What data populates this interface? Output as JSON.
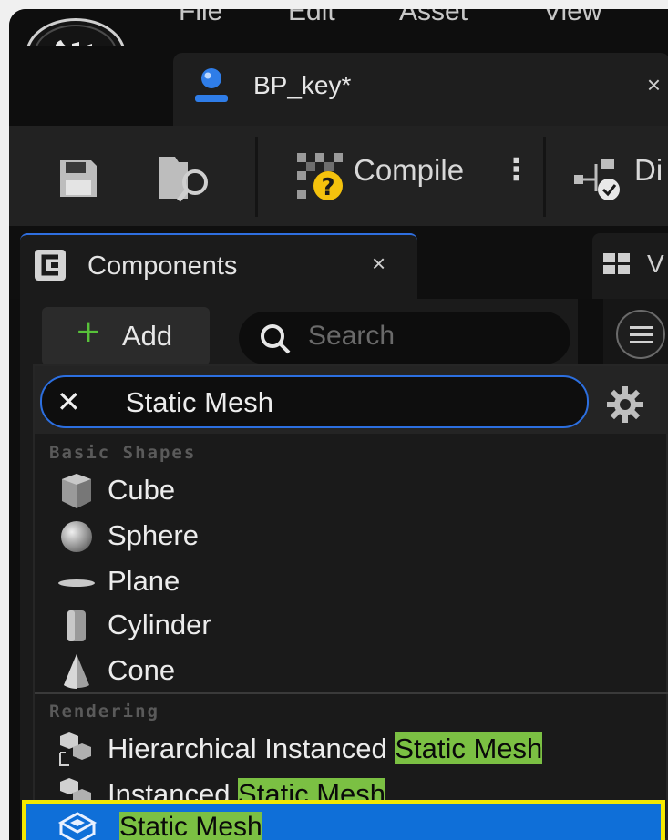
{
  "menubar": {
    "items": [
      "File",
      "Edit",
      "Asset",
      "View"
    ]
  },
  "document_tab": {
    "title": "BP_key*",
    "close": "×"
  },
  "toolbar": {
    "compile_label": "Compile",
    "more": "⋮",
    "diff_label": "Di"
  },
  "components_panel": {
    "tab_label": "Components",
    "tab_close": "×",
    "add_label": "Add",
    "search_placeholder": "Search"
  },
  "viewport_tab": {
    "label": "V"
  },
  "add_menu": {
    "filter_value": "Static Mesh",
    "categories": [
      {
        "name": "Basic Shapes",
        "items": [
          {
            "label": "Cube",
            "icon": "cube-icon"
          },
          {
            "label": "Sphere",
            "icon": "sphere-icon"
          },
          {
            "label": "Plane",
            "icon": "plane-icon"
          },
          {
            "label": "Cylinder",
            "icon": "cylinder-icon"
          },
          {
            "label": "Cone",
            "icon": "cone-icon"
          }
        ]
      },
      {
        "name": "Rendering",
        "items": [
          {
            "prefix": "Hierarchical Instanced ",
            "match": "Static Mesh",
            "icon": "instanced-mesh-icon"
          },
          {
            "prefix": "Instanced ",
            "match": "Static Mesh",
            "icon": "instanced-mesh-icon"
          },
          {
            "prefix": "",
            "match": "Static Mesh",
            "icon": "static-mesh-icon",
            "selected": true
          }
        ]
      }
    ]
  },
  "colors": {
    "accent_blue": "#2c6fe0",
    "match_highlight": "#7bc043",
    "selection_blue": "#0f6fd8",
    "selection_outline": "#f5e800",
    "add_plus_green": "#58c23a"
  }
}
